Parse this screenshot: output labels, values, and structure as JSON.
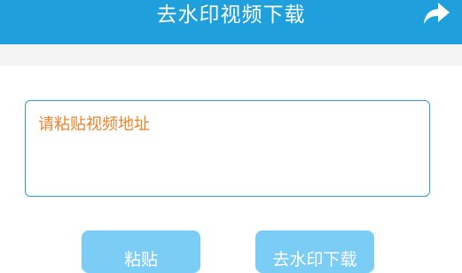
{
  "header": {
    "title": "去水印视频下载",
    "share_icon": "share-arrow-icon"
  },
  "input": {
    "placeholder": "请粘贴视频地址",
    "value": ""
  },
  "buttons": {
    "paste_label": "粘贴",
    "download_label": "去水印下载"
  },
  "colors": {
    "header_bg": "#1fa0dd",
    "placeholder_text": "#e8842c",
    "input_border": "#2a9fd8",
    "button_bg": "#7ccdf6"
  }
}
